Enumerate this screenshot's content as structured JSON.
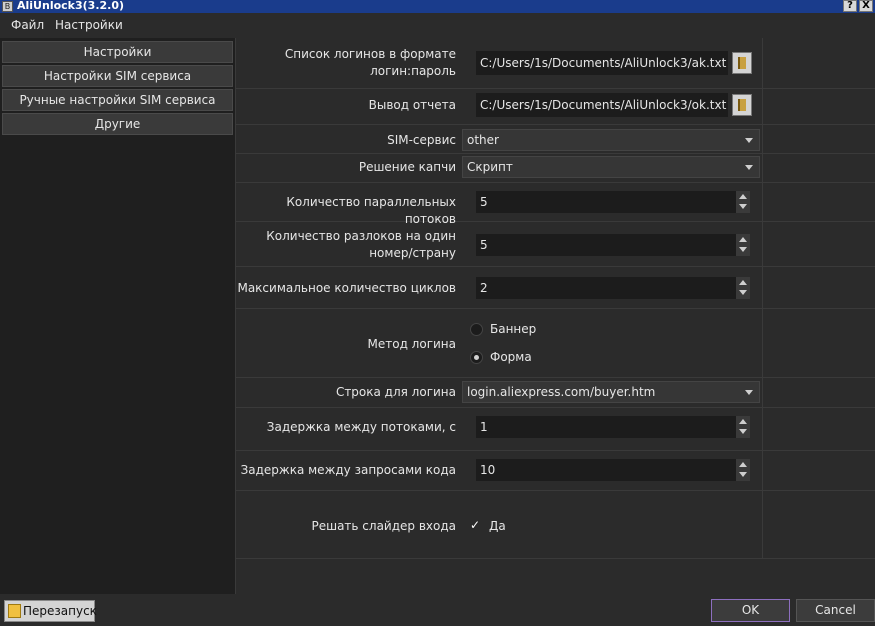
{
  "window": {
    "title": "AliUnlock3(3.2.0)",
    "help_label": "?",
    "close_label": "X",
    "accent": "#1a3c8c"
  },
  "menu": {
    "items": [
      "Файл",
      "Настройки"
    ]
  },
  "sidebar": {
    "items": [
      {
        "label": "Настройки"
      },
      {
        "label": "Настройки SIM сервиса"
      },
      {
        "label": "Ручные настройки SIM сервиса"
      },
      {
        "label": "Другие"
      }
    ]
  },
  "settings": {
    "logins_file": {
      "label_line1": "Список логинов в формате",
      "label_line2": "логин:пароль",
      "value": "C:/Users/1s/Documents/AliUnlock3/ak.txt"
    },
    "report_file": {
      "label": "Вывод отчета",
      "value": "C:/Users/1s/Documents/AliUnlock3/ok.txt"
    },
    "sim_service": {
      "label": "SIM-сервис",
      "value": "other"
    },
    "captcha": {
      "label": "Решение капчи",
      "value": "Скрипт"
    },
    "threads": {
      "label": "Количество параллельных потоков",
      "value": "5"
    },
    "unlocks_per_number": {
      "label_line1": "Количество разлоков на один",
      "label_line2": "номер/страну",
      "value": "5"
    },
    "max_cycles": {
      "label": "Максимальное количество циклов",
      "value": "2"
    },
    "login_method": {
      "label": "Метод логина",
      "options": [
        {
          "label": "Баннер",
          "checked": false
        },
        {
          "label": "Форма",
          "checked": true
        }
      ]
    },
    "login_url": {
      "label": "Строка для логина",
      "value": "login.aliexpress.com/buyer.htm"
    },
    "thread_delay": {
      "label": "Задержка между потоками, с",
      "value": "1"
    },
    "code_delay": {
      "label": "Задержка между запросами кода",
      "value": "10"
    },
    "slider": {
      "label": "Решать слайдер входа",
      "checkbox_label": "Да",
      "checked": true
    }
  },
  "footer": {
    "restart_label": "Перезапуск",
    "ok_label": "OK",
    "cancel_label": "Cancel"
  }
}
